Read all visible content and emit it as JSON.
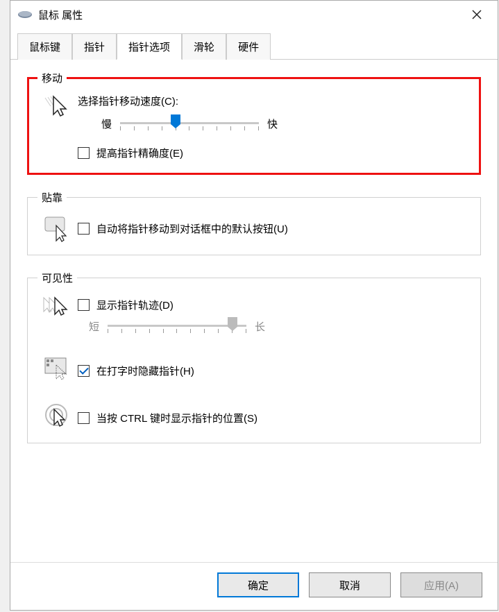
{
  "window": {
    "title": "鼠标 属性"
  },
  "tabs": {
    "items": [
      "鼠标键",
      "指针",
      "指针选项",
      "滑轮",
      "硬件"
    ],
    "activeIndex": 2
  },
  "motion": {
    "legend": "移动",
    "speed_label": "选择指针移动速度(C):",
    "slow": "慢",
    "fast": "快",
    "speed_value": 5,
    "speed_max": 11,
    "precision_label": "提高指针精确度(E)",
    "precision_checked": false
  },
  "snap": {
    "legend": "贴靠",
    "snap_label": "自动将指针移动到对话框中的默认按钮(U)",
    "snap_checked": false
  },
  "visibility": {
    "legend": "可见性",
    "trail_label": "显示指针轨迹(D)",
    "trail_checked": false,
    "trail_short": "短",
    "trail_long": "长",
    "trail_value": 10,
    "trail_max": 11,
    "hide_label": "在打字时隐藏指针(H)",
    "hide_checked": true,
    "ctrl_label": "当按 CTRL 键时显示指针的位置(S)",
    "ctrl_checked": false
  },
  "buttons": {
    "ok": "确定",
    "cancel": "取消",
    "apply": "应用(A)"
  }
}
